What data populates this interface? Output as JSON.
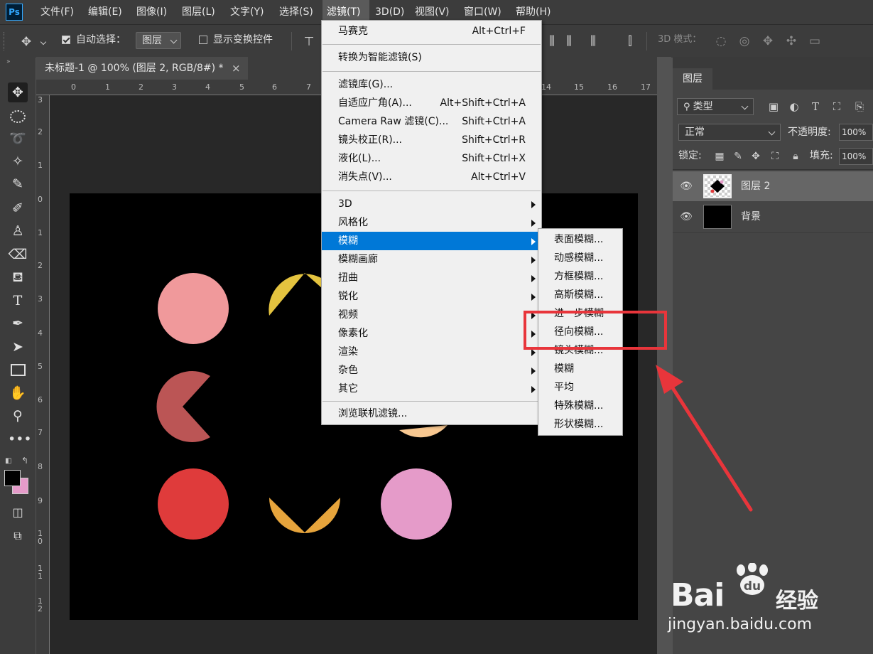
{
  "app": {
    "logo": "Ps"
  },
  "menubar": {
    "items": [
      "文件(F)",
      "编辑(E)",
      "图像(I)",
      "图层(L)",
      "文字(Y)",
      "选择(S)",
      "滤镜(T)",
      "3D(D)",
      "视图(V)",
      "窗口(W)",
      "帮助(H)"
    ],
    "active": "滤镜(T)"
  },
  "options": {
    "auto_select_label": "自动选择：",
    "auto_select_checked": true,
    "auto_select_target": "图层",
    "show_transform_label": "显示变换控件",
    "show_transform_checked": false,
    "mode_3d_label": "3D 模式："
  },
  "document": {
    "tab_title": "未标题-1 @ 100% (图层 2, RGB/8#) *",
    "close_glyph": "×",
    "ruler_h": [
      "0",
      "1",
      "2",
      "3",
      "4",
      "5",
      "6",
      "7",
      "14",
      "15",
      "16",
      "17"
    ],
    "ruler_v": [
      "3",
      "2",
      "1",
      "0",
      "1",
      "2",
      "3",
      "4",
      "5",
      "6",
      "7",
      "8",
      "9",
      "1 0",
      "1 1",
      "1 2"
    ]
  },
  "filter_menu": {
    "items": [
      {
        "label": "马赛克",
        "shortcut": "Alt+Ctrl+F"
      },
      {
        "label": "转换为智能滤镜(S)",
        "shortcut": ""
      },
      {
        "label": "滤镜库(G)...",
        "shortcut": ""
      },
      {
        "label": "自适应广角(A)...",
        "shortcut": "Alt+Shift+Ctrl+A"
      },
      {
        "label": "Camera Raw 滤镜(C)...",
        "shortcut": "Shift+Ctrl+A"
      },
      {
        "label": "镜头校正(R)...",
        "shortcut": "Shift+Ctrl+R"
      },
      {
        "label": "液化(L)...",
        "shortcut": "Shift+Ctrl+X"
      },
      {
        "label": "消失点(V)...",
        "shortcut": "Alt+Ctrl+V"
      },
      {
        "label": "3D",
        "submenu": true
      },
      {
        "label": "风格化",
        "submenu": true
      },
      {
        "label": "模糊",
        "submenu": true,
        "highlighted": true
      },
      {
        "label": "模糊画廊",
        "submenu": true
      },
      {
        "label": "扭曲",
        "submenu": true
      },
      {
        "label": "锐化",
        "submenu": true
      },
      {
        "label": "视频",
        "submenu": true
      },
      {
        "label": "像素化",
        "submenu": true
      },
      {
        "label": "渲染",
        "submenu": true
      },
      {
        "label": "杂色",
        "submenu": true
      },
      {
        "label": "其它",
        "submenu": true
      },
      {
        "label": "浏览联机滤镜...",
        "shortcut": ""
      }
    ]
  },
  "blur_submenu": {
    "items": [
      "表面模糊...",
      "动感模糊...",
      "方框模糊...",
      "高斯模糊...",
      "进一步模糊",
      "径向模糊...",
      "镜头模糊...",
      "模糊",
      "平均",
      "特殊模糊...",
      "形状模糊..."
    ],
    "callout_target": "径向模糊..."
  },
  "layers_panel": {
    "tab": "图层",
    "kind_filter": "类型",
    "blend_mode": "正常",
    "opacity_label": "不透明度:",
    "opacity_value": "100%",
    "lock_label": "锁定:",
    "fill_label": "填充:",
    "fill_value": "100%",
    "layers": [
      {
        "name": "图层 2",
        "selected": true,
        "visible": true
      },
      {
        "name": "背景",
        "selected": false,
        "visible": true
      }
    ]
  },
  "colors": {
    "shape_pink": "#f0999b",
    "shape_yellow": "#e4c33f",
    "shape_darkred": "#bb5555",
    "shape_peach": "#f8c891",
    "shape_red": "#df3b3b",
    "shape_orange": "#e6a43c",
    "shape_magenta": "#e59bc9",
    "highlight_blue": "#0078d7",
    "annotation_red": "#e8353b",
    "foreground": "#000000",
    "background": "#e59bc9"
  },
  "watermark": {
    "brand": "Bai",
    "brand_suffix": "经验",
    "url": "jingyan.baidu.com"
  }
}
